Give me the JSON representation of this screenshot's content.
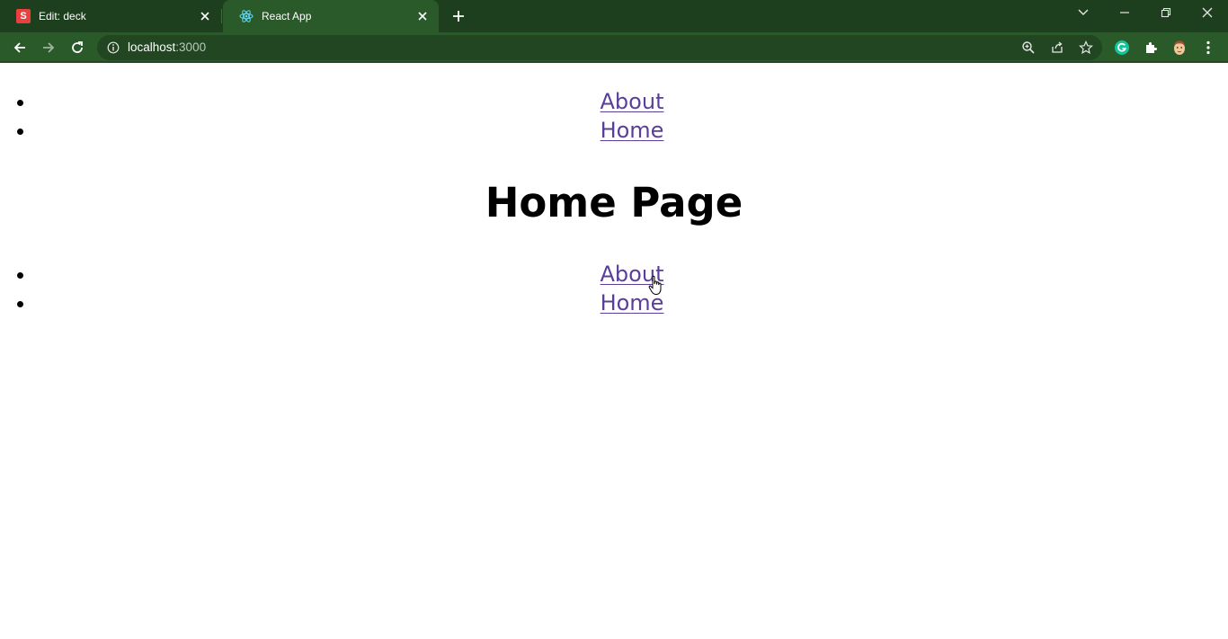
{
  "browser": {
    "tabs": [
      {
        "title": "Edit: deck",
        "favicon": "slides-s-icon",
        "favicon_letter": "S",
        "active": false
      },
      {
        "title": "React App",
        "favicon": "react-icon",
        "active": true
      }
    ],
    "address": {
      "host": "localhost",
      "port": ":3000"
    },
    "colors": {
      "frame": "#1d3f1d",
      "toolbar": "#2a5a2a",
      "link": "#5a3f9a"
    }
  },
  "page": {
    "nav_top": [
      "About",
      "Home"
    ],
    "title": "Home Page",
    "nav_bottom": [
      "About",
      "Home"
    ]
  }
}
